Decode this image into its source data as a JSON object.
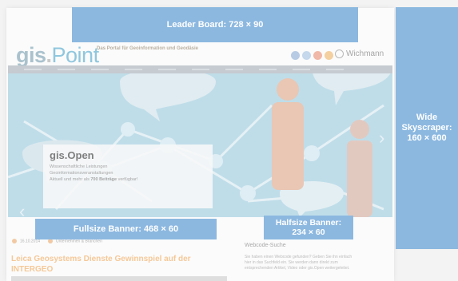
{
  "site": {
    "logo_main": "gis",
    "logo_dot": ".",
    "logo_accent": "Point",
    "tagline": "Das Portal für Geoinformation und Geodäsie",
    "brand": "Wichmann",
    "social_icons": [
      "social-icon",
      "social-icon",
      "social-icon",
      "social-icon"
    ]
  },
  "hero": {
    "title": "gis.Open",
    "text_1": "Wissenschaftliche Leistungen",
    "text_2": "Geoinformationsveranstaltungen",
    "text_3": "Aktuell und mehr als",
    "text_bold": "700 Beiträge",
    "text_4": "verfügbar!"
  },
  "article": {
    "date": "16.10.2014",
    "category": "Unternehmen & Branchen",
    "title": "Leica Geosystems Dienste Gewinnspiel auf der INTERGEO"
  },
  "sidebar": {
    "title": "Webcode-Suche",
    "text": "Sie haben einen Webcode gefunden? Geben Sie ihn einfach hier in das Suchfeld ein. Sie werden dann direkt zum entsprechenden Artikel, Video oder gis.Open weitergeleitet."
  },
  "ads": {
    "leader": "Leader Board: 728 × 90",
    "sky_1": "Wide",
    "sky_2": "Skyscraper:",
    "sky_3": "160 × 600",
    "full": "Fullsize Banner: 468 × 60",
    "half_1": "Halfsize Banner:",
    "half_2": "234 × 60"
  }
}
